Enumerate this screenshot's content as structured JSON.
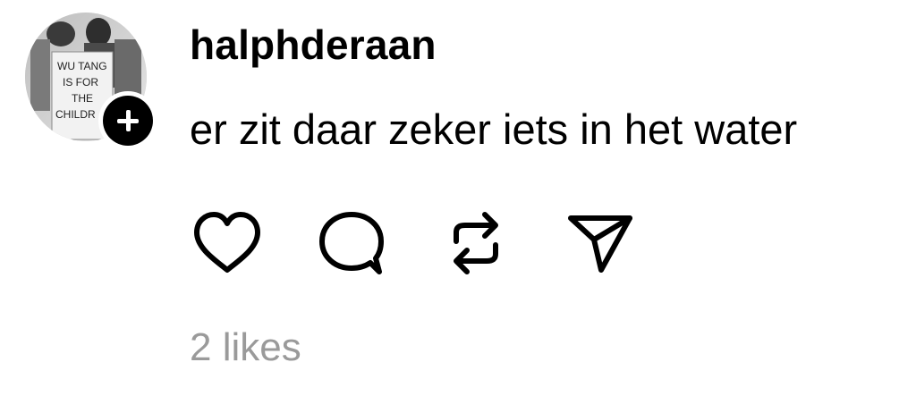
{
  "post": {
    "username": "halphderaan",
    "text": "er zit daar zeker iets in het water",
    "avatar": {
      "sign_lines": [
        "WU TANG",
        "IS FOR",
        "THE",
        "CHILDR"
      ]
    },
    "follow_button": {
      "icon": "plus-icon",
      "color": "#000000"
    },
    "actions": [
      {
        "name": "like",
        "icon": "heart-icon"
      },
      {
        "name": "comment",
        "icon": "comment-bubble-icon"
      },
      {
        "name": "repost",
        "icon": "repost-icon"
      },
      {
        "name": "share",
        "icon": "send-icon"
      }
    ],
    "likes_label": "2 likes",
    "colors": {
      "text": "#000000",
      "muted": "#9a9a9a",
      "background": "#ffffff"
    }
  }
}
